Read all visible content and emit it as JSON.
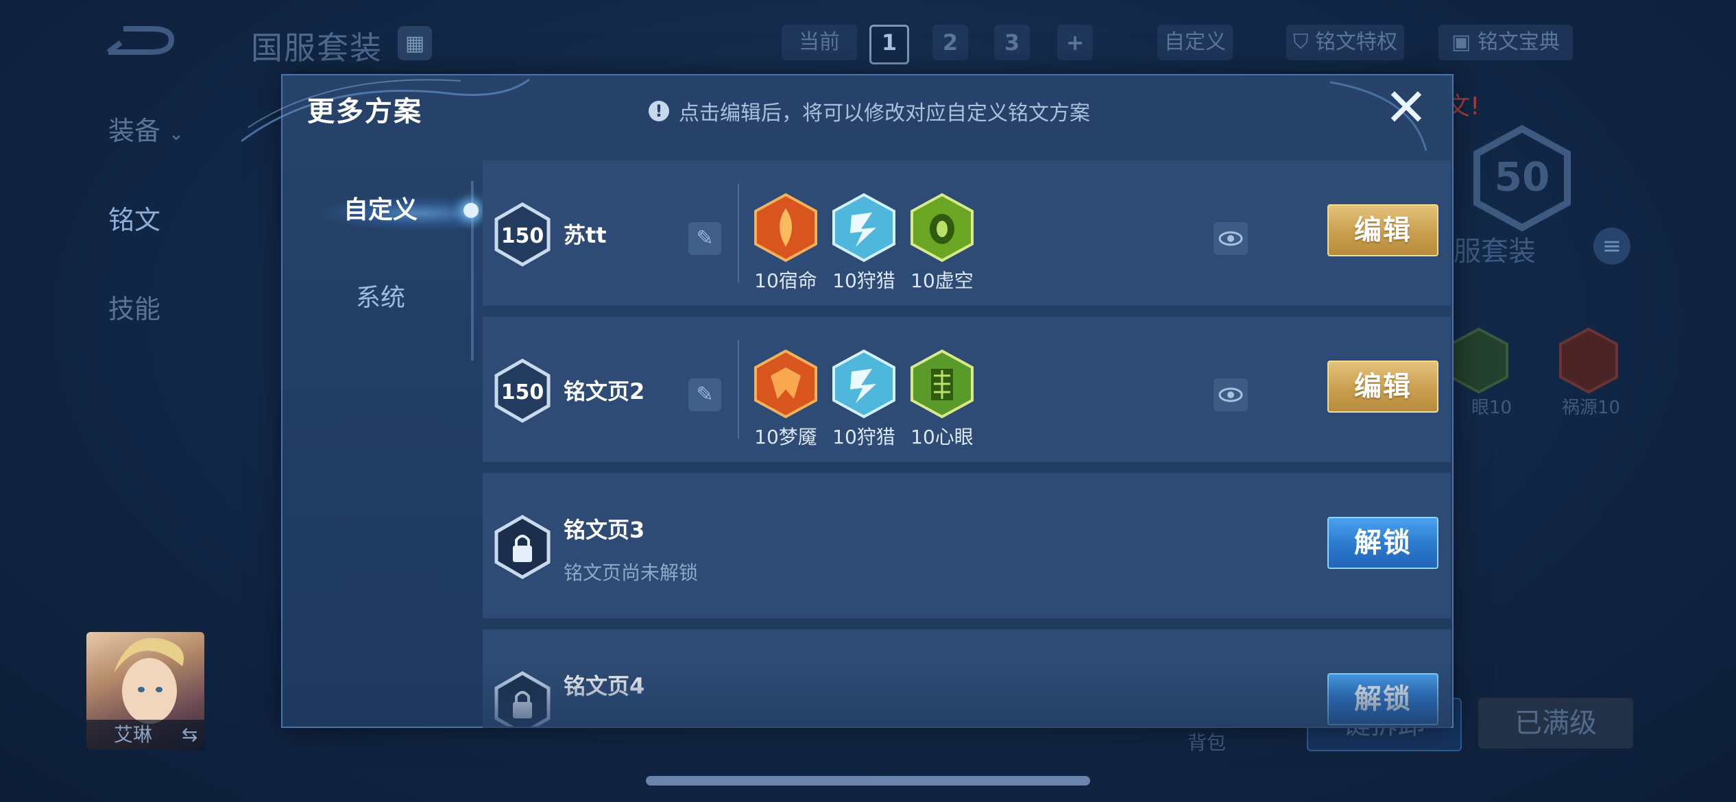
{
  "background": {
    "title": "国服套装",
    "top_pills": {
      "current": "当前",
      "pages": [
        "1",
        "2",
        "3"
      ],
      "active_page": "1",
      "add": "+",
      "custom": "自定义",
      "privilege": "铭文特权",
      "codex": "铭文宝典"
    },
    "tabs": [
      "装备",
      "铭文",
      "技能"
    ],
    "selected_tab": "铭文",
    "right_panel": {
      "alert_text": "文!",
      "level_fragment": "50",
      "set_title_fragment": "服套装",
      "rune_labels": [
        "眼10",
        "祸源10"
      ]
    },
    "hero_name": "艾琳",
    "bag_label": "背包",
    "bottom_buttons": [
      "键拆卸",
      "已满级"
    ]
  },
  "modal": {
    "title": "更多方案",
    "hint": "点击编辑后，将可以修改对应自定义铭文方案",
    "close_label": "✕",
    "side_nav": [
      "自定义",
      "系统"
    ],
    "selected_nav": "自定义",
    "pages": [
      {
        "level": "150",
        "name": "苏tt",
        "runes": [
          {
            "label": "10宿命",
            "color": "#d9551f"
          },
          {
            "label": "10狩猎",
            "color": "#4fb6dc"
          },
          {
            "label": "10虚空",
            "color": "#6aa524"
          }
        ],
        "action": "编辑",
        "locked": false
      },
      {
        "level": "150",
        "name": "铭文页2",
        "runes": [
          {
            "label": "10梦魇",
            "color": "#d9551f"
          },
          {
            "label": "10狩猎",
            "color": "#4fb6dc"
          },
          {
            "label": "10心眼",
            "color": "#5a9a2a"
          }
        ],
        "action": "编辑",
        "locked": false
      },
      {
        "name": "铭文页3",
        "status": "铭文页尚未解锁",
        "action": "解锁",
        "locked": true
      },
      {
        "name": "铭文页4",
        "action": "解锁",
        "locked": true
      }
    ]
  },
  "colors": {
    "edit_gold": "#c99f4f",
    "unlock_blue": "#2b78cc",
    "panel_bg": "#213c62"
  }
}
